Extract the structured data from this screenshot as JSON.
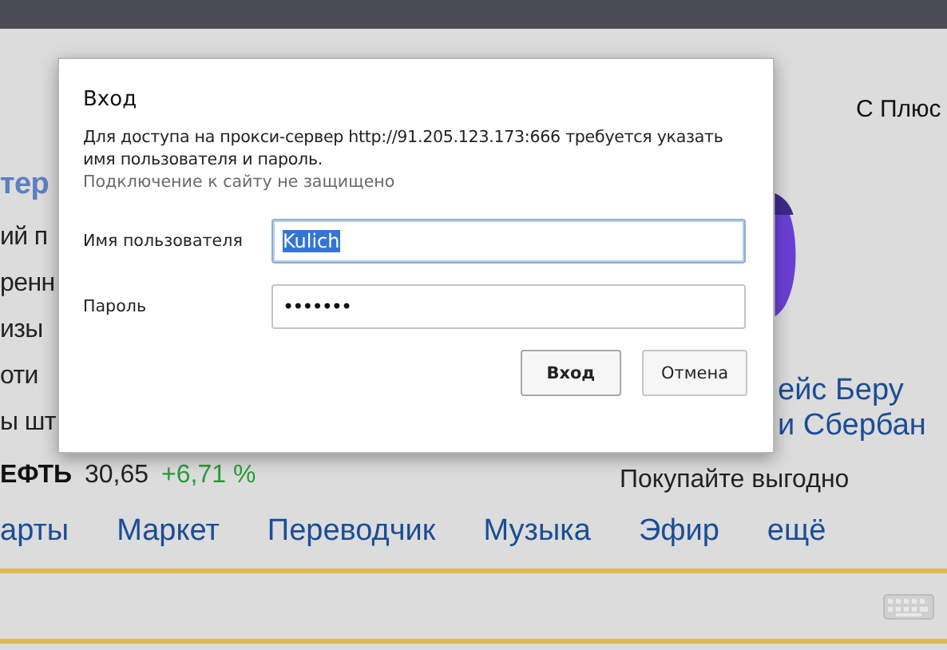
{
  "page": {
    "left_fragments": [
      {
        "text": "тер",
        "kind": "heading"
      },
      {
        "text": "ий п",
        "kind": "line"
      },
      {
        "text": "ренн",
        "kind": "line"
      },
      {
        "text": "изы",
        "kind": "line"
      },
      {
        "text": "оти",
        "kind": "line"
      },
      {
        "text": "ы шт",
        "kind": "line"
      }
    ],
    "quote": {
      "name": "ЕФТЬ",
      "value": "30,65",
      "change": "+6,71 %"
    },
    "right": {
      "top_link": "С Плюс",
      "promo_lines": [
        "ейс Беру",
        "и Сбербан"
      ],
      "promo_caption": "Покупайте выгодно"
    },
    "nav": [
      "арты",
      "Маркет",
      "Переводчик",
      "Музыка",
      "Эфир",
      "ещё"
    ]
  },
  "dialog": {
    "title": "Вход",
    "message": "Для доступа на прокси-сервер http://91.205.123.173:666 требуется указать имя пользователя и пароль.",
    "warning": "Подключение к сайту не защищено",
    "fields": [
      {
        "label": "Имя пользователя",
        "value": "Kulich",
        "kind": "text",
        "focused": true,
        "text_selected": true
      },
      {
        "label": "Пароль",
        "value": "•••••••",
        "kind": "password",
        "focused": false,
        "text_selected": false
      }
    ],
    "buttons": [
      {
        "label": "Вход",
        "default": true
      },
      {
        "label": "Отмена",
        "default": false
      }
    ]
  }
}
